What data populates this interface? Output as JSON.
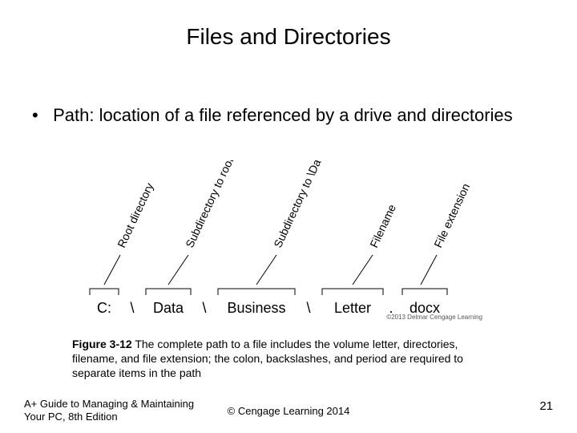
{
  "title": "Files and Directories",
  "bullet": "Path: location of a file referenced by a drive and directories",
  "diagram": {
    "labels": [
      "Root directory",
      "Subdirectory to root",
      "Subdirectory to \\Data",
      "Filename",
      "File extension"
    ],
    "parts": [
      "C:",
      "Data",
      "Business",
      "Letter",
      "docx"
    ],
    "seps": [
      "\\",
      "\\",
      "\\",
      "."
    ],
    "credit": "©2013 Delmar Cengage Learning"
  },
  "caption": {
    "lead": "Figure 3-12",
    "text": " The complete path to a file includes the volume letter, directories, filename, and file extension; the colon, backslashes, and period are required to separate items in the path"
  },
  "footer": {
    "left": "A+ Guide to Managing & Maintaining\nYour PC, 8th Edition",
    "center": "© Cengage Learning 2014",
    "right": "21"
  }
}
